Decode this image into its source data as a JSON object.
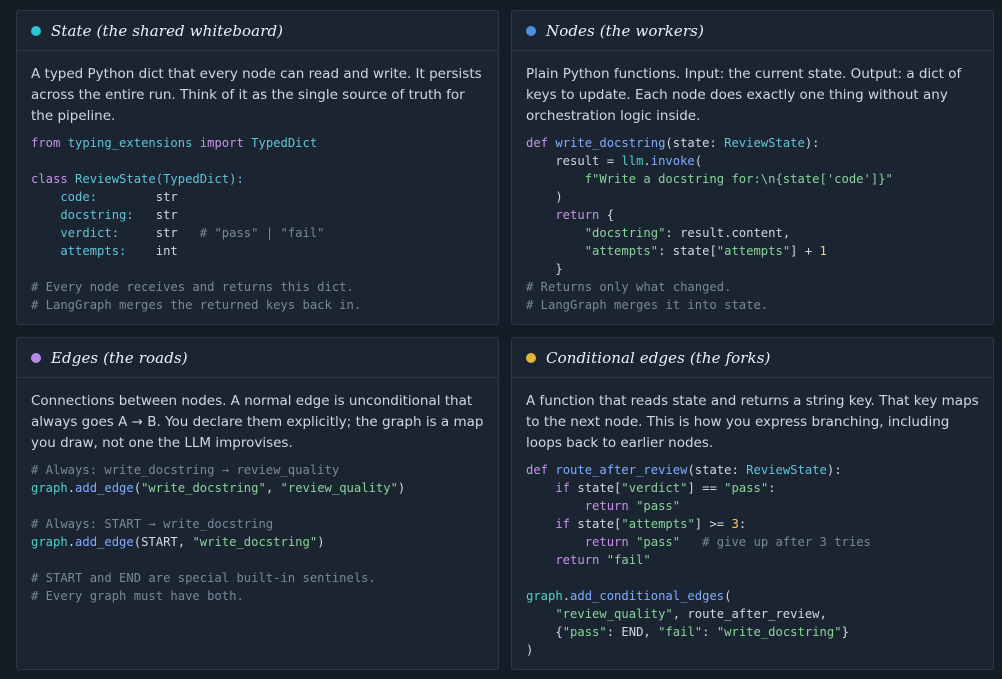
{
  "colors": {
    "background": "#141c26",
    "card": "#1b2532",
    "border": "#2b3746",
    "state_dot": "#2ec4d4",
    "nodes_dot": "#4f8fe0",
    "edges_dot": "#b58be6",
    "conditional_dot": "#e3b733"
  },
  "cards": {
    "state": {
      "title": "State (the shared whiteboard)",
      "description": "A typed Python dict that every node can read and write. It persists across the entire run. Think of it as the single source of truth for the pipeline.",
      "code": {
        "l1": {
          "a": "from",
          "b": " typing_extensions ",
          "c": "import",
          "d": " TypedDict"
        },
        "l3": {
          "a": "class",
          "b": " ReviewState(TypedDict):"
        },
        "l4": {
          "a": "    code:        ",
          "b": "str"
        },
        "l5": {
          "a": "    docstring:   ",
          "b": "str"
        },
        "l6": {
          "a": "    verdict:     ",
          "b": "str",
          "c": "   # \"pass\" | \"fail\""
        },
        "l7": {
          "a": "    attempts:    ",
          "b": "int"
        },
        "l9": "# Every node receives and returns this dict.",
        "l10": "# LangGraph merges the returned keys back in."
      }
    },
    "nodes": {
      "title": "Nodes (the workers)",
      "description": "Plain Python functions. Input: the current state. Output: a dict of keys to update. Each node does exactly one thing without any orchestration logic inside.",
      "code": {
        "l1": {
          "a": "def",
          "b": " write_docstring",
          "c": "(state: ",
          "d": "ReviewState",
          "e": "):"
        },
        "l2": {
          "a": "    result = ",
          "b": "llm",
          "c": ".",
          "d": "invoke",
          "e": "("
        },
        "l3": "        f\"Write a docstring for:\\n{state['code']}\"",
        "l4": "    )",
        "l5": {
          "a": "    return",
          "b": " {"
        },
        "l6": {
          "a": "        \"docstring\"",
          "b": ": result.content,"
        },
        "l7": {
          "a": "        \"attempts\"",
          "b": ": state[",
          "c": "\"attempts\"",
          "d": "] + ",
          "e": "1"
        },
        "l8": "    }",
        "l9": "# Returns only what changed.",
        "l10": "# LangGraph merges it into state."
      }
    },
    "edges": {
      "title": "Edges (the roads)",
      "description": "Connections between nodes. A normal edge is unconditional that always goes A → B. You declare them explicitly; the graph is a map you draw, not one the LLM improvises.",
      "code": {
        "l1": "# Always: write_docstring → review_quality",
        "l2": {
          "a": "graph",
          "b": ".",
          "c": "add_edge",
          "d": "(",
          "e": "\"write_docstring\"",
          "f": ", ",
          "g": "\"review_quality\"",
          "h": ")"
        },
        "l4": "# Always: START → write_docstring",
        "l5": {
          "a": "graph",
          "b": ".",
          "c": "add_edge",
          "d": "(START, ",
          "e": "\"write_docstring\"",
          "f": ")"
        },
        "l7": "# START and END are special built-in sentinels.",
        "l8": "# Every graph must have both."
      }
    },
    "conditional": {
      "title": "Conditional edges (the forks)",
      "description": "A function that reads state and returns a string key. That key maps to the next node. This is how you express branching, including loops back to earlier nodes.",
      "code": {
        "l1": {
          "a": "def",
          "b": " route_after_review",
          "c": "(state: ",
          "d": "ReviewState",
          "e": "):"
        },
        "l2": {
          "a": "    if",
          "b": " state[",
          "c": "\"verdict\"",
          "d": "] == ",
          "e": "\"pass\"",
          "f": ":"
        },
        "l3": {
          "a": "        return",
          "b": " \"pass\""
        },
        "l4": {
          "a": "    if",
          "b": " state[",
          "c": "\"attempts\"",
          "d": "] >= ",
          "e": "3",
          "f": ":"
        },
        "l5": {
          "a": "        return",
          "b": " \"pass\"",
          "c": "   # give up after 3 tries"
        },
        "l6": {
          "a": "    return",
          "b": " \"fail\""
        },
        "l8": {
          "a": "graph",
          "b": ".",
          "c": "add_conditional_edges",
          "d": "("
        },
        "l9": {
          "a": "    \"review_quality\"",
          "b": ", route_after_review,"
        },
        "l10": {
          "a": "    {",
          "b": "\"pass\"",
          "c": ": END, ",
          "d": "\"fail\"",
          "e": ": ",
          "f": "\"write_docstring\"",
          "g": "}"
        },
        "l11": ")"
      }
    }
  }
}
